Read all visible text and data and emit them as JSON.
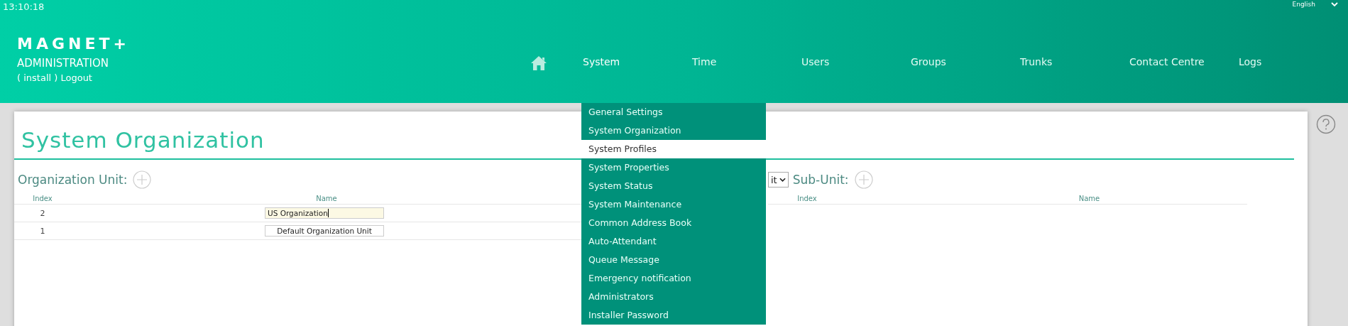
{
  "header": {
    "clock": "13:10:18",
    "language": "English",
    "logo": "MAGNET+",
    "subtitle": "ADMINISTRATION",
    "user": "( install ) Logout"
  },
  "nav": [
    {
      "label": "System",
      "selected": true
    },
    {
      "label": "Time",
      "selected": false
    },
    {
      "label": "Users",
      "selected": false
    },
    {
      "label": "Groups",
      "selected": false
    },
    {
      "label": "Trunks",
      "selected": false
    },
    {
      "label": "Contact Centre",
      "selected": false
    },
    {
      "label": "Logs",
      "selected": false
    }
  ],
  "dropdown": [
    {
      "label": "General Settings",
      "selected": false
    },
    {
      "label": "System Organization",
      "selected": false
    },
    {
      "label": "System Profiles",
      "selected": true
    },
    {
      "label": "System Properties",
      "selected": false
    },
    {
      "label": "System Status",
      "selected": false
    },
    {
      "label": "System Maintenance",
      "selected": false
    },
    {
      "label": "Common Address Book",
      "selected": false
    },
    {
      "label": "Auto-Attendant",
      "selected": false
    },
    {
      "label": "Queue Message",
      "selected": false
    },
    {
      "label": "Emergency notification",
      "selected": false
    },
    {
      "label": "Administrators",
      "selected": false
    },
    {
      "label": "Installer Password",
      "selected": false
    }
  ],
  "page": {
    "title": "System Organization"
  },
  "org_units": {
    "label": "Organization Unit:",
    "columns": [
      "Index",
      "Name"
    ],
    "rows": [
      {
        "index": "2",
        "name": "US Organization",
        "editing": true
      },
      {
        "index": "1",
        "name": "Default Organization Unit",
        "editing": false
      }
    ]
  },
  "sub_units": {
    "select_value": "it",
    "label": "Sub-Unit:",
    "columns": [
      "Index",
      "Name"
    ]
  }
}
